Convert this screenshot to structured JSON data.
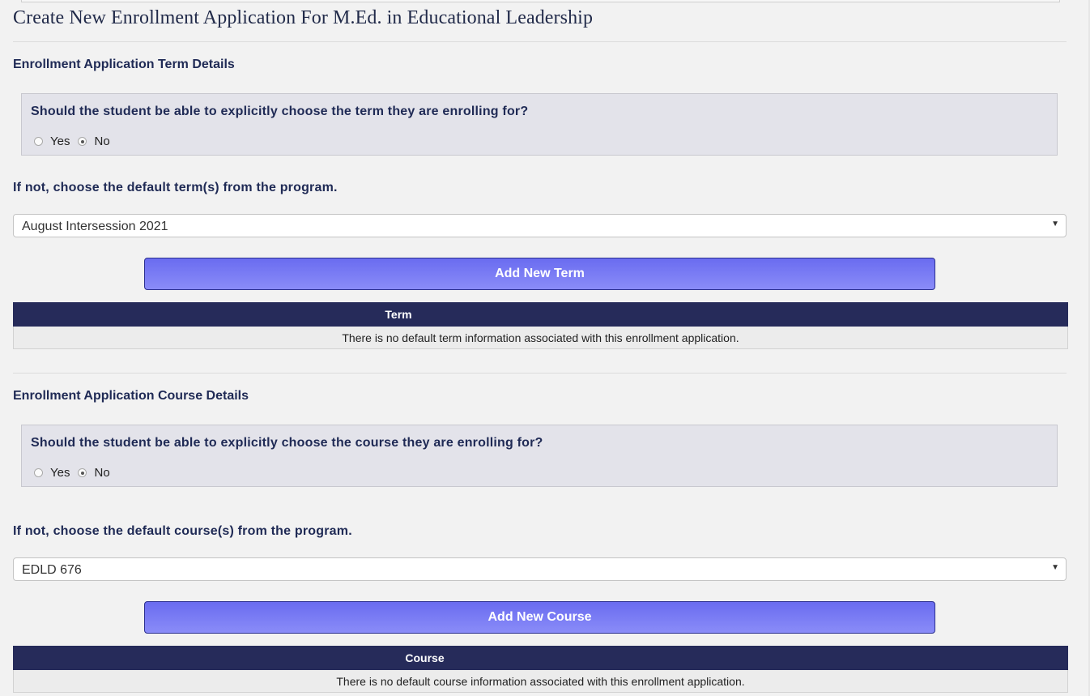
{
  "page": {
    "title": "Create New Enrollment Application For M.Ed. in Educational Leadership"
  },
  "term_section": {
    "heading": "Enrollment Application Term Details",
    "question": "Should the student be able to explicitly choose the term they are enrolling for?",
    "options": [
      "Yes",
      "No"
    ],
    "selected": "No",
    "default_label": "If not, choose the default term(s) from the program.",
    "select_value": "August Intersession 2021",
    "add_button": "Add New Term",
    "table": {
      "columns": [
        "Term",
        ""
      ],
      "empty_message": "There is no default term information associated with this enrollment application."
    }
  },
  "course_section": {
    "heading": "Enrollment Application Course Details",
    "question": "Should the student be able to explicitly choose the course they are enrolling for?",
    "options": [
      "Yes",
      "No"
    ],
    "selected": "No",
    "default_label": "If not, choose the default course(s) from the program.",
    "select_value": "EDLD 676",
    "add_button": "Add New Course",
    "table": {
      "columns": [
        "Course",
        ""
      ],
      "empty_message": "There is no default course information associated with this enrollment application."
    }
  },
  "icons": {
    "select_arrow": "dropdown-arrow-icon"
  },
  "colors": {
    "table_header_bg": "#262b5a",
    "button_gradient_top": "#6a6cf0",
    "button_gradient_bottom": "#8a8cf8",
    "heading_text": "#1f2a55"
  }
}
